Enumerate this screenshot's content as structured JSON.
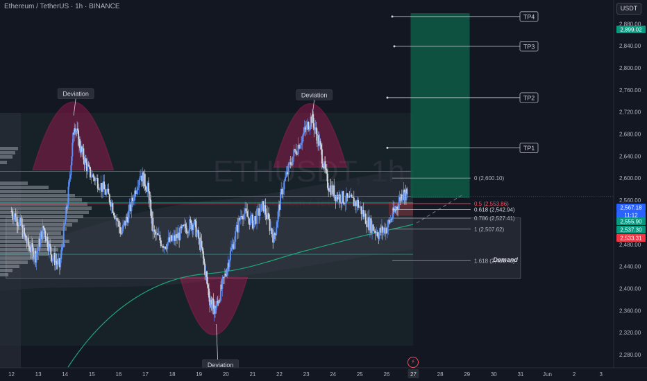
{
  "header": {
    "symbol_line": "Ethereum / TetherUS · 1h · BINANCE",
    "currency_button": "USDT"
  },
  "watermark": {
    "symbol": "ETHUSDT, 1h",
    "name": "Ethereum / TetherUS"
  },
  "colors": {
    "background": "#131722",
    "bull": "#5b8ff9",
    "bear": "#d1d4dc",
    "arc_fill": "#c2185b",
    "arc_stroke": "#e91e63",
    "target_zone": "#0f5c47",
    "tp_line": "#d1d4dc",
    "ema": "#1fa67a"
  },
  "chart_data": {
    "type": "candlestick",
    "y_axis": {
      "ylim": [
        2270,
        2925
      ],
      "ticks": [
        2280,
        2320,
        2360,
        2400,
        2440,
        2480,
        2520,
        2560,
        2600,
        2640,
        2680,
        2720,
        2760,
        2800,
        2840,
        2880
      ],
      "tick_labels": [
        "2,280.00",
        "2,320.00",
        "2,360.00",
        "2,400.00",
        "2,440.00",
        "2,480.00",
        "2,520.00",
        "2,560.00",
        "2,600.00",
        "2,640.00",
        "2,680.00",
        "2,720.00",
        "2,760.00",
        "2,800.00",
        "2,840.00",
        "2,880.00"
      ]
    },
    "x_axis": {
      "ticks": [
        "12",
        "13",
        "14",
        "15",
        "16",
        "17",
        "18",
        "19",
        "20",
        "21",
        "22",
        "23",
        "24",
        "25",
        "26",
        "27",
        "28",
        "29",
        "30",
        "31",
        "Jun",
        "2",
        "3"
      ],
      "highlighted_tick": "27"
    },
    "candles_close_path": [
      {
        "day": 12.0,
        "price": 2540
      },
      {
        "day": 12.3,
        "price": 2520
      },
      {
        "day": 12.6,
        "price": 2480
      },
      {
        "day": 12.9,
        "price": 2460
      },
      {
        "day": 13.2,
        "price": 2510
      },
      {
        "day": 13.5,
        "price": 2460
      },
      {
        "day": 13.8,
        "price": 2440
      },
      {
        "day": 14.1,
        "price": 2560
      },
      {
        "day": 14.35,
        "price": 2700
      },
      {
        "day": 14.6,
        "price": 2650
      },
      {
        "day": 14.9,
        "price": 2610
      },
      {
        "day": 15.3,
        "price": 2590
      },
      {
        "day": 15.7,
        "price": 2560
      },
      {
        "day": 16.1,
        "price": 2500
      },
      {
        "day": 16.4,
        "price": 2540
      },
      {
        "day": 16.8,
        "price": 2610
      },
      {
        "day": 17.1,
        "price": 2580
      },
      {
        "day": 17.3,
        "price": 2500
      },
      {
        "day": 17.7,
        "price": 2480
      },
      {
        "day": 18.1,
        "price": 2490
      },
      {
        "day": 18.5,
        "price": 2510
      },
      {
        "day": 18.8,
        "price": 2520
      },
      {
        "day": 19.1,
        "price": 2470
      },
      {
        "day": 19.4,
        "price": 2380
      },
      {
        "day": 19.6,
        "price": 2360
      },
      {
        "day": 19.9,
        "price": 2410
      },
      {
        "day": 20.2,
        "price": 2470
      },
      {
        "day": 20.6,
        "price": 2540
      },
      {
        "day": 21.0,
        "price": 2520
      },
      {
        "day": 21.4,
        "price": 2550
      },
      {
        "day": 21.8,
        "price": 2490
      },
      {
        "day": 22.1,
        "price": 2580
      },
      {
        "day": 22.5,
        "price": 2640
      },
      {
        "day": 22.9,
        "price": 2680
      },
      {
        "day": 23.2,
        "price": 2710
      },
      {
        "day": 23.5,
        "price": 2660
      },
      {
        "day": 23.8,
        "price": 2590
      },
      {
        "day": 24.1,
        "price": 2570
      },
      {
        "day": 24.5,
        "price": 2560
      },
      {
        "day": 24.9,
        "price": 2555
      },
      {
        "day": 25.3,
        "price": 2520
      },
      {
        "day": 25.7,
        "price": 2500
      },
      {
        "day": 26.0,
        "price": 2510
      },
      {
        "day": 26.3,
        "price": 2540
      },
      {
        "day": 26.6,
        "price": 2575
      },
      {
        "day": 26.8,
        "price": 2567
      }
    ],
    "deviation_labels": [
      {
        "label": "Deviation",
        "day": 14.4,
        "price": 2735
      },
      {
        "label": "Deviation",
        "day": 23.3,
        "price": 2733
      },
      {
        "label": "Deviation",
        "day": 19.8,
        "price": 2350
      }
    ],
    "deviation_arcs": [
      {
        "day_start": 12.8,
        "day_end": 15.8,
        "peak": 2738,
        "base": 2615,
        "direction": "up"
      },
      {
        "day_start": 21.8,
        "day_end": 24.5,
        "peak": 2735,
        "base": 2620,
        "direction": "up"
      },
      {
        "day_start": 18.3,
        "day_end": 20.8,
        "peak": 2316,
        "base": 2420,
        "direction": "down"
      }
    ],
    "take_profits": [
      {
        "label": "TP1",
        "price": 2655
      },
      {
        "label": "TP2",
        "price": 2746
      },
      {
        "label": "TP3",
        "price": 2839
      },
      {
        "label": "TP4",
        "price": 2893
      }
    ],
    "target_zone": {
      "day_start": 27.0,
      "day_end": 29.1,
      "price_low": 2564,
      "price_high": 2899
    },
    "fib_levels": [
      {
        "ratio": "0",
        "value": "2,600.10",
        "price": 2600.1,
        "color": "#b2b5be"
      },
      {
        "ratio": "0.5",
        "value": "2,553.86",
        "price": 2553.86,
        "color": "#f7525f"
      },
      {
        "ratio": "0.618",
        "value": "2,542.94",
        "price": 2542.94,
        "color": "#d1d4dc"
      },
      {
        "ratio": "0.786",
        "value": "2,527.41",
        "price": 2527.41,
        "color": "#b2b5be"
      },
      {
        "ratio": "1",
        "value": "2,507.62",
        "price": 2507.62,
        "color": "#b2b5be"
      },
      {
        "ratio": "1.618",
        "value": "2,450.46",
        "price": 2450.46,
        "color": "#b2b5be"
      }
    ],
    "demand_zone": {
      "label": "Demand",
      "day_start": 11.8,
      "day_end": 31.0,
      "price_low": 2418,
      "price_high": 2528
    },
    "horizontal_lines": [
      2612,
      2567,
      2556,
      2462
    ],
    "price_badges": [
      {
        "value": "2,899.02",
        "color": "#089981"
      },
      {
        "value": "2,567.18",
        "color": "#2962ff"
      },
      {
        "value": "11:12",
        "color": "#2962ff"
      },
      {
        "value": "2,555.90",
        "color": "#089981"
      },
      {
        "value": "2,537.30",
        "color": "#089981"
      },
      {
        "value": "2,533.31",
        "color": "#f23645"
      }
    ]
  }
}
